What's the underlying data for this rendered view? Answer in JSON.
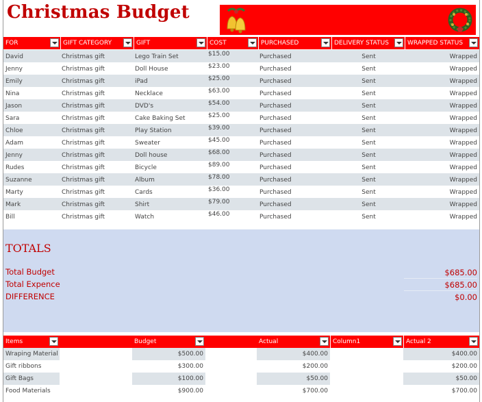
{
  "title": "Christmas Budget",
  "banner": {
    "left_icon": "bells-icon",
    "right_icon": "wreath-icon"
  },
  "table": {
    "headers": [
      "FOR",
      "GIFT CATEGORY",
      "GIFT",
      "COST",
      "PURCHASED",
      "DELIVERY STATUS",
      "WRAPPED STATUS"
    ],
    "rows": [
      [
        "David",
        "Christmas gift",
        "Lego Train Set",
        "$15.00",
        "Purchased",
        "Sent",
        "Wrapped"
      ],
      [
        "Jenny",
        "Christmas gift",
        "Doll House",
        "$23.00",
        "Purchased",
        "Sent",
        "Wrapped"
      ],
      [
        "Emily",
        "Christmas gift",
        "iPad",
        "$25.00",
        "Purchased",
        "Sent",
        "Wrapped"
      ],
      [
        "Nina",
        "Christmas gift",
        "Necklace",
        "$63.00",
        "Purchased",
        "Sent",
        "Wrapped"
      ],
      [
        "Jason",
        "Christmas gift",
        "DVD's",
        "$54.00",
        "Purchased",
        "Sent",
        "Wrapped"
      ],
      [
        "Sara",
        "Christmas gift",
        "Cake Baking Set",
        "$25.00",
        "Purchased",
        "Sent",
        "Wrapped"
      ],
      [
        "Chloe",
        "Christmas gift",
        "Play Station",
        "$39.00",
        "Purchased",
        "Sent",
        "Wrapped"
      ],
      [
        "Adam",
        "Christmas gift",
        "Sweater",
        "$45.00",
        "Purchased",
        "Sent",
        "Wrapped"
      ],
      [
        "Jenny",
        "Christmas gift",
        "Doll house",
        "$68.00",
        "Purchased",
        "Sent",
        "Wrapped"
      ],
      [
        "Rudes",
        "Christmas gift",
        "Bicycle",
        "$89.00",
        "Purchased",
        "Sent",
        "Wrapped"
      ],
      [
        "Suzanne",
        "Christmas gift",
        "Album",
        "$78.00",
        "Purchased",
        "Sent",
        "Wrapped"
      ],
      [
        "Marty",
        "Christmas gift",
        "Cards",
        "$36.00",
        "Purchased",
        "Sent",
        "Wrapped"
      ],
      [
        "Mark",
        "Christmas gift",
        "Shirt",
        "$79.00",
        "Purchased",
        "Sent",
        "Wrapped"
      ],
      [
        "Bill",
        "Christmas gift",
        "Watch",
        "$46.00",
        "Purchased",
        "Sent",
        "Wrapped"
      ]
    ]
  },
  "totals": {
    "heading": "TOTALS",
    "items": [
      {
        "label": "Total Budget",
        "value": "$685.00"
      },
      {
        "label": "Total Expence",
        "value": "$685.00"
      },
      {
        "label": "DIFFERENCE",
        "value": "$0.00"
      }
    ]
  },
  "budget_table": {
    "headers": [
      "Items",
      "",
      "Budget",
      "",
      "Actual",
      "Column1",
      "Actual 2"
    ],
    "rows": [
      {
        "item": "Wraping Material",
        "budget": "$500.00",
        "actual": "$400.00",
        "actual2": "$400.00"
      },
      {
        "item": "Gift ribbons",
        "budget": "$300.00",
        "actual": "$200.00",
        "actual2": "$200.00"
      },
      {
        "item": "Gift Bags",
        "budget": "$100.00",
        "actual": "$50.00",
        "actual2": "$50.00"
      },
      {
        "item": "Food Materials",
        "budget": "$900.00",
        "actual": "$700.00",
        "actual2": "$700.00"
      }
    ]
  },
  "colors": {
    "accent": "#ff0000",
    "title": "#c00000",
    "stripe": "#dde3e8",
    "totals_bg": "#cfdaf0"
  }
}
